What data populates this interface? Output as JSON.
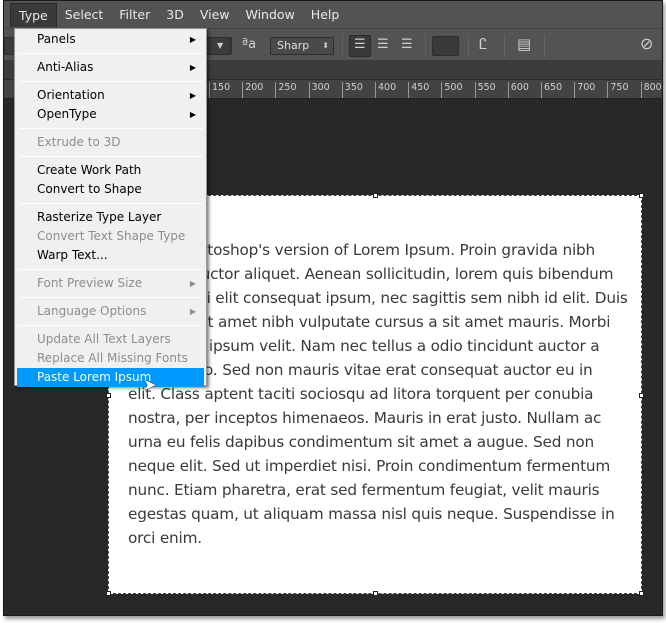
{
  "menubar": [
    "Type",
    "Select",
    "Filter",
    "3D",
    "View",
    "Window",
    "Help"
  ],
  "toolbar": {
    "antialias": "Sharp",
    "antialias_icon": "aa-icon",
    "color_swatch": "#3a3a3a"
  },
  "ruler": [
    "150",
    "200",
    "250",
    "300",
    "350",
    "400",
    "450",
    "500",
    "550",
    "600",
    "650",
    "700",
    "750",
    "800"
  ],
  "type_menu": [
    {
      "label": "Panels",
      "submenu": true
    },
    "sep",
    {
      "label": "Anti-Alias",
      "submenu": true
    },
    "sep",
    {
      "label": "Orientation",
      "submenu": true
    },
    {
      "label": "OpenType",
      "submenu": true
    },
    "sep",
    {
      "label": "Extrude to 3D",
      "disabled": true
    },
    "sep",
    {
      "label": "Create Work Path"
    },
    {
      "label": "Convert to Shape"
    },
    "sep",
    {
      "label": "Rasterize Type Layer"
    },
    {
      "label": "Convert Text Shape Type",
      "disabled": true
    },
    {
      "label": "Warp Text..."
    },
    "sep",
    {
      "label": "Font Preview Size",
      "disabled": true,
      "submenu": true
    },
    "sep",
    {
      "label": "Language Options",
      "disabled": true,
      "submenu": true
    },
    "sep",
    {
      "label": "Update All Text Layers",
      "disabled": true
    },
    {
      "label": "Replace All Missing Fonts",
      "disabled": true
    },
    {
      "label": "Paste Lorem Ipsum",
      "highlighted": true
    }
  ],
  "text_lines": [
    "This is Photoshop's version  of Lorem Ipsum. Proin gravida nibh",
    "vel velit auctor aliquet. Aenean sollicitudin, lorem quis bibendum",
    "auctor, nisi elit consequat ipsum, nec sagittis sem nibh id elit. Duis",
    "sed odio sit amet nibh vulputate cursus a sit amet mauris. Morbi",
    "accumsan ipsum velit. Nam nec tellus a odio tincidunt auctor a",
    "ornare odio. Sed non  mauris vitae erat consequat auctor eu in",
    "elit. Class aptent taciti sociosqu ad litora torquent per conubia",
    "nostra, per inceptos himenaeos. Mauris in erat justo. Nullam ac",
    "urna eu felis dapibus condimentum sit amet a augue. Sed non",
    "neque elit. Sed ut imperdiet nisi. Proin condimentum fermentum",
    "nunc. Etiam pharetra, erat sed fermentum feugiat, velit mauris",
    "egestas quam, ut aliquam massa nisl quis neque. Suspendisse in",
    "orci enim."
  ]
}
